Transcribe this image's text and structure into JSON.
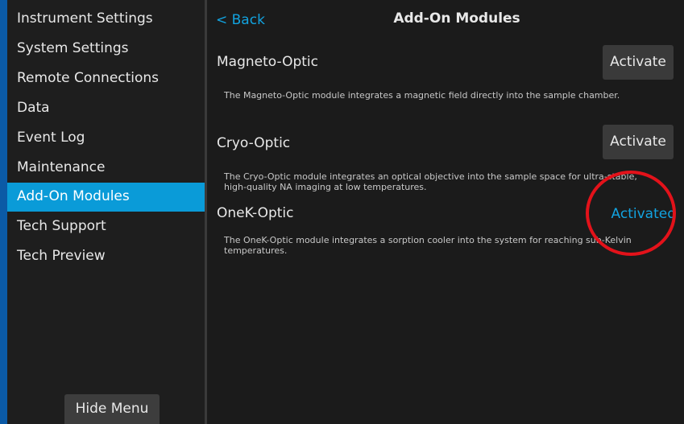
{
  "sidebar": {
    "items": [
      {
        "label": "Instrument Settings"
      },
      {
        "label": "System Settings"
      },
      {
        "label": "Remote Connections"
      },
      {
        "label": "Data"
      },
      {
        "label": "Event Log"
      },
      {
        "label": "Maintenance"
      },
      {
        "label": "Add-On Modules",
        "active": true
      },
      {
        "label": "Tech Support"
      },
      {
        "label": "Tech Preview"
      }
    ],
    "hide_menu_label": "Hide Menu"
  },
  "header": {
    "back_label": "< Back",
    "title": "Add-On Modules"
  },
  "modules": [
    {
      "name": "Magneto-Optic",
      "description": "The Magneto-Optic module integrates a magnetic field directly into the sample chamber.",
      "action_label": "Activate",
      "status": "inactive"
    },
    {
      "name": "Cryo-Optic",
      "description": "The Cryo-Optic module integrates an optical objective into the sample space for ultra-stable, high-quality NA imaging at low temperatures.",
      "action_label": "Activate",
      "status": "inactive"
    },
    {
      "name": "OneK-Optic",
      "description": "The OneK-Optic module integrates a sorption cooler into the system for reaching sub-Kelvin temperatures.",
      "action_label": "Activated",
      "status": "activated"
    }
  ],
  "colors": {
    "accent": "#0a9bd8",
    "link": "#12a3e0",
    "annotation": "#e3121a",
    "background": "#1b1b1b"
  }
}
